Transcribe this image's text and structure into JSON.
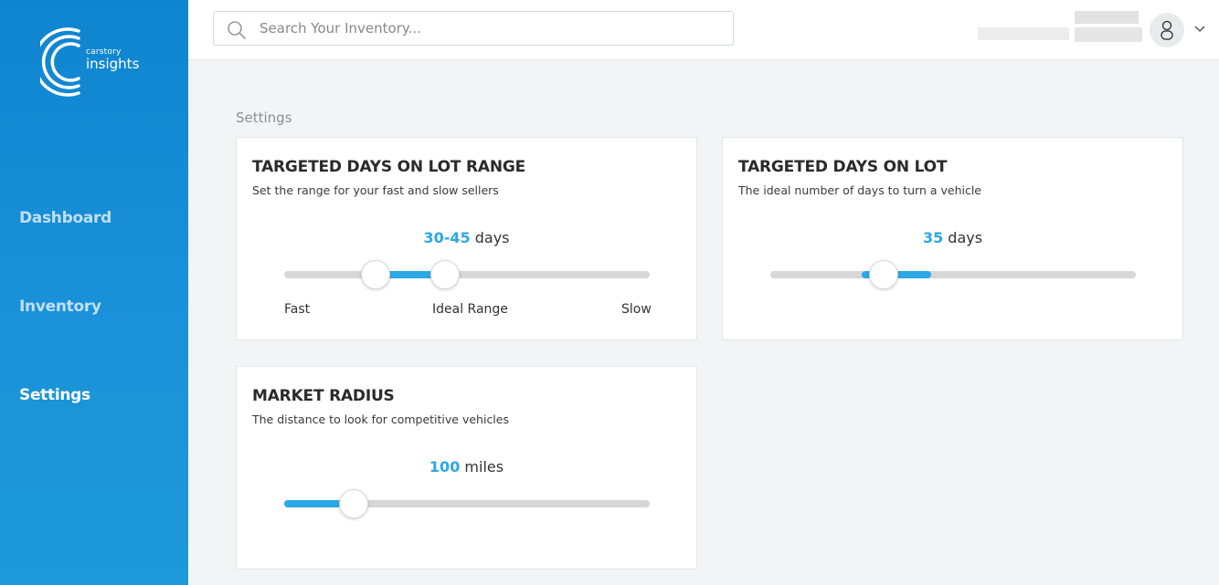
{
  "app": {
    "brand": "carstory",
    "name": "insights"
  },
  "sidebar": {
    "items": [
      {
        "label": "Dashboard",
        "active": false
      },
      {
        "label": "Inventory",
        "active": false
      },
      {
        "label": "Settings",
        "active": true
      }
    ]
  },
  "topbar": {
    "search_placeholder": "Search Your Inventory...",
    "icons": [
      "search-icon",
      "user-icon",
      "chevron-down-icon"
    ]
  },
  "page": {
    "title": "Settings"
  },
  "cards": {
    "lot_range": {
      "title": "TARGETED DAYS ON LOT RANGE",
      "subtitle": "Set the range for your fast and slow sellers",
      "value": "30-45",
      "unit": "days",
      "range_fraction": [
        0.25,
        0.44
      ],
      "labels": {
        "left": "Fast",
        "center": "Ideal Range",
        "right": "Slow"
      }
    },
    "lot_days": {
      "title": "TARGETED DAYS ON LOT",
      "subtitle": "The ideal number of days to turn a vehicle",
      "value": "35",
      "unit": "days",
      "fill_fraction": [
        0.25,
        0.44
      ],
      "handle_fraction": 0.31
    },
    "market_radius": {
      "title": "MARKET RADIUS",
      "subtitle": "The distance to look for competitive vehicles",
      "value": "100",
      "unit": "miles",
      "fill_fraction": 0.19
    }
  },
  "colors": {
    "accent": "#2ba8e6",
    "sidebar": "#1a90d8",
    "track": "#d7d7d7"
  }
}
